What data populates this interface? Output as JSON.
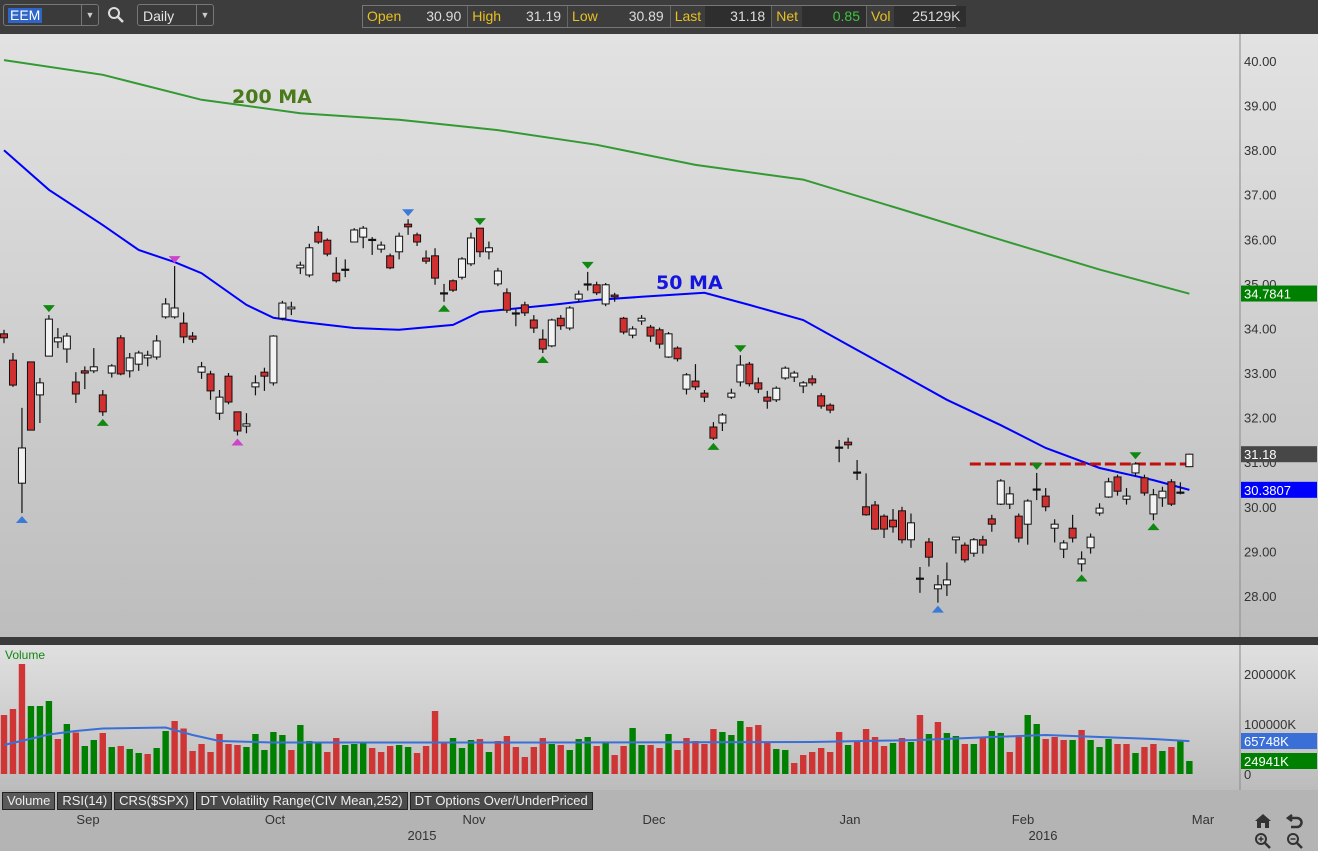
{
  "toolbar": {
    "symbol": "EEM",
    "interval": "Daily",
    "quote": [
      {
        "label": "Open",
        "value": "30.90"
      },
      {
        "label": "High",
        "value": "31.19"
      },
      {
        "label": "Low",
        "value": "30.89"
      },
      {
        "label": "Last",
        "value": "31.18"
      },
      {
        "label": "Net",
        "value": "0.85"
      },
      {
        "label": "Vol",
        "value": "25129K"
      }
    ]
  },
  "tabs": [
    "Volume",
    "RSI(14)",
    "CRS($SPX)",
    "DT Volatility Range(CIV Mean,252)",
    "DT Options Over/UnderPriced"
  ],
  "x_axis": {
    "months": [
      "Sep",
      "Oct",
      "Nov",
      "Dec",
      "Jan",
      "Feb",
      "Mar"
    ],
    "years": [
      "2015",
      "2016"
    ]
  },
  "colors": {
    "up_body": "#f2f2f2",
    "down_body": "#d03030",
    "vol_up": "#008000",
    "vol_down": "#d03535",
    "ma50": "#0000ff",
    "ma200": "#339933",
    "vol_ma": "#3a6fd8",
    "resistance": "#c01010"
  },
  "chart_data": {
    "type": "candlestick",
    "symbol": "EEM",
    "price_axis": {
      "ticks": [
        "28.00",
        "29.00",
        "30.00",
        "31.00",
        "32.00",
        "33.00",
        "34.00",
        "35.00",
        "36.00",
        "37.00",
        "38.00",
        "39.00",
        "40.00"
      ],
      "range": [
        27.5,
        40.5
      ]
    },
    "annotations": {
      "ma200_label": "200 MA",
      "ma50_label": "50 MA",
      "resistance_level": 30.96,
      "resistance_from_index": 108
    },
    "last_labels": {
      "ma200": "34.7841",
      "last": "31.18",
      "ma50": "30.3807"
    },
    "ohlc": [
      [
        33.88,
        33.97,
        33.67,
        33.79
      ],
      [
        33.29,
        33.45,
        32.69,
        32.73
      ],
      [
        30.53,
        32.22,
        29.86,
        31.32
      ],
      [
        33.25,
        33.25,
        31.72,
        31.72
      ],
      [
        32.51,
        32.89,
        31.88,
        32.78
      ],
      [
        33.38,
        34.3,
        33.38,
        34.21
      ],
      [
        33.7,
        34.01,
        33.56,
        33.79
      ],
      [
        33.54,
        33.9,
        33.23,
        33.83
      ],
      [
        32.8,
        33.02,
        32.33,
        32.53
      ],
      [
        33.05,
        33.15,
        32.64,
        33.0
      ],
      [
        33.05,
        33.56,
        33.0,
        33.14
      ],
      [
        32.51,
        32.62,
        32.04,
        32.13
      ],
      [
        33.0,
        33.2,
        32.9,
        33.16
      ],
      [
        33.79,
        33.85,
        32.95,
        32.98
      ],
      [
        33.05,
        33.45,
        32.9,
        33.34
      ],
      [
        33.2,
        33.5,
        33.05,
        33.45
      ],
      [
        33.34,
        33.5,
        33.15,
        33.4
      ],
      [
        33.36,
        33.85,
        33.3,
        33.72
      ],
      [
        34.26,
        34.68,
        34.22,
        34.55
      ],
      [
        34.26,
        35.4,
        34.22,
        34.46
      ],
      [
        34.12,
        34.36,
        33.67,
        33.81
      ],
      [
        33.83,
        33.92,
        33.68,
        33.76
      ],
      [
        33.02,
        33.25,
        32.87,
        33.14
      ],
      [
        32.98,
        33.05,
        32.4,
        32.6
      ],
      [
        32.1,
        32.62,
        31.95,
        32.46
      ],
      [
        32.93,
        33.0,
        32.3,
        32.35
      ],
      [
        32.13,
        32.13,
        31.6,
        31.7
      ],
      [
        31.81,
        32.1,
        31.65,
        31.86
      ],
      [
        32.69,
        32.95,
        32.5,
        32.78
      ],
      [
        33.02,
        33.12,
        32.6,
        32.93
      ],
      [
        32.78,
        33.85,
        32.72,
        33.83
      ],
      [
        34.23,
        34.62,
        34.18,
        34.57
      ],
      [
        34.44,
        34.6,
        34.3,
        34.48
      ],
      [
        35.36,
        35.5,
        35.22,
        35.42
      ],
      [
        35.2,
        35.9,
        35.15,
        35.81
      ],
      [
        36.16,
        36.3,
        35.9,
        35.94
      ],
      [
        35.98,
        36.02,
        35.62,
        35.67
      ],
      [
        35.24,
        35.6,
        35.03,
        35.07
      ],
      [
        35.33,
        35.55,
        35.15,
        35.33
      ],
      [
        35.94,
        36.25,
        35.94,
        36.21
      ],
      [
        36.05,
        36.3,
        35.8,
        36.25
      ],
      [
        36.0,
        36.05,
        35.65,
        36.0
      ],
      [
        35.78,
        35.95,
        35.7,
        35.87
      ],
      [
        35.63,
        35.68,
        35.33,
        35.36
      ],
      [
        35.72,
        36.15,
        35.55,
        36.07
      ],
      [
        36.34,
        36.45,
        36.1,
        36.28
      ],
      [
        36.1,
        36.15,
        35.85,
        35.94
      ],
      [
        35.58,
        35.75,
        35.45,
        35.51
      ],
      [
        35.63,
        35.8,
        34.98,
        35.13
      ],
      [
        34.8,
        35.0,
        34.6,
        34.8
      ],
      [
        35.07,
        35.1,
        34.82,
        34.86
      ],
      [
        35.15,
        35.6,
        35.1,
        35.56
      ],
      [
        35.45,
        36.15,
        35.4,
        36.03
      ],
      [
        36.25,
        36.25,
        35.6,
        35.72
      ],
      [
        35.72,
        35.95,
        35.55,
        35.81
      ],
      [
        35.0,
        35.36,
        34.95,
        35.29
      ],
      [
        34.8,
        34.9,
        34.35,
        34.41
      ],
      [
        34.35,
        34.43,
        34.05,
        34.35
      ],
      [
        34.53,
        34.6,
        34.28,
        34.35
      ],
      [
        34.19,
        34.3,
        33.9,
        34.01
      ],
      [
        33.76,
        33.98,
        33.45,
        33.54
      ],
      [
        33.61,
        34.22,
        33.58,
        34.19
      ],
      [
        34.23,
        34.3,
        33.97,
        34.06
      ],
      [
        34.01,
        34.5,
        33.96,
        34.46
      ],
      [
        34.66,
        34.85,
        34.6,
        34.77
      ],
      [
        35.0,
        35.27,
        34.85,
        35.0
      ],
      [
        34.98,
        35.05,
        34.75,
        34.8
      ],
      [
        34.55,
        35.02,
        34.5,
        34.98
      ],
      [
        34.75,
        34.8,
        34.6,
        34.71
      ],
      [
        34.23,
        34.26,
        33.87,
        33.92
      ],
      [
        33.85,
        34.05,
        33.78,
        33.99
      ],
      [
        34.17,
        34.3,
        34.08,
        34.23
      ],
      [
        34.03,
        34.08,
        33.7,
        33.83
      ],
      [
        33.97,
        34.02,
        33.55,
        33.65
      ],
      [
        33.36,
        33.92,
        33.34,
        33.88
      ],
      [
        33.56,
        33.6,
        33.26,
        33.32
      ],
      [
        32.64,
        33.0,
        32.52,
        32.96
      ],
      [
        32.82,
        33.2,
        32.62,
        32.69
      ],
      [
        32.55,
        32.62,
        32.35,
        32.46
      ],
      [
        31.79,
        31.9,
        31.5,
        31.54
      ],
      [
        31.88,
        32.1,
        31.7,
        32.06
      ],
      [
        32.46,
        32.65,
        32.42,
        32.55
      ],
      [
        32.8,
        33.4,
        32.7,
        33.18
      ],
      [
        33.2,
        33.25,
        32.7,
        32.76
      ],
      [
        32.78,
        32.9,
        32.55,
        32.64
      ],
      [
        32.46,
        32.6,
        32.2,
        32.37
      ],
      [
        32.4,
        32.7,
        32.35,
        32.66
      ],
      [
        32.89,
        33.15,
        32.85,
        33.11
      ],
      [
        32.91,
        33.05,
        32.8,
        33.0
      ],
      [
        32.71,
        32.82,
        32.55,
        32.78
      ],
      [
        32.87,
        32.95,
        32.72,
        32.78
      ],
      [
        32.49,
        32.55,
        32.2,
        32.26
      ],
      [
        32.28,
        32.32,
        32.1,
        32.17
      ],
      [
        31.34,
        31.5,
        31.0,
        31.34
      ],
      [
        31.45,
        31.55,
        31.3,
        31.39
      ],
      [
        30.78,
        31.05,
        30.6,
        30.78
      ],
      [
        30.0,
        30.75,
        29.8,
        29.82
      ],
      [
        30.04,
        30.13,
        29.48,
        29.5
      ],
      [
        29.79,
        29.83,
        29.3,
        29.5
      ],
      [
        29.7,
        29.95,
        29.42,
        29.55
      ],
      [
        29.91,
        30.0,
        29.18,
        29.26
      ],
      [
        29.26,
        29.85,
        29.08,
        29.64
      ],
      [
        28.4,
        28.65,
        28.07,
        28.4
      ],
      [
        29.21,
        29.3,
        28.66,
        28.87
      ],
      [
        28.16,
        28.47,
        27.85,
        28.25
      ],
      [
        28.25,
        28.75,
        28.0,
        28.36
      ],
      [
        29.26,
        29.32,
        28.95,
        29.32
      ],
      [
        29.14,
        29.2,
        28.75,
        28.81
      ],
      [
        28.96,
        29.3,
        28.88,
        29.26
      ],
      [
        29.26,
        29.35,
        28.95,
        29.14
      ],
      [
        29.73,
        29.82,
        29.44,
        29.61
      ],
      [
        30.06,
        30.62,
        30.04,
        30.58
      ],
      [
        30.06,
        30.45,
        29.95,
        30.29
      ],
      [
        29.79,
        29.85,
        29.2,
        29.3
      ],
      [
        29.61,
        30.17,
        29.15,
        30.13
      ],
      [
        30.4,
        30.76,
        30.15,
        30.4
      ],
      [
        30.24,
        30.42,
        29.9,
        30.0
      ],
      [
        29.52,
        29.72,
        29.2,
        29.61
      ],
      [
        29.05,
        29.25,
        28.85,
        29.19
      ],
      [
        29.52,
        29.82,
        29.2,
        29.3
      ],
      [
        28.72,
        29.0,
        28.55,
        28.83
      ],
      [
        29.08,
        29.4,
        28.95,
        29.32
      ],
      [
        29.86,
        30.08,
        29.8,
        29.97
      ],
      [
        30.22,
        30.65,
        30.2,
        30.56
      ],
      [
        30.67,
        30.72,
        30.25,
        30.35
      ],
      [
        30.17,
        30.42,
        30.05,
        30.24
      ],
      [
        30.76,
        31.0,
        30.7,
        30.96
      ],
      [
        30.65,
        30.72,
        30.25,
        30.31
      ],
      [
        29.84,
        30.4,
        29.7,
        30.27
      ],
      [
        30.2,
        30.45,
        30.0,
        30.35
      ],
      [
        30.56,
        30.62,
        30.02,
        30.06
      ],
      [
        30.33,
        30.55,
        30.28,
        30.33
      ],
      [
        30.9,
        31.19,
        30.89,
        31.18
      ]
    ],
    "ma200": [
      [
        0,
        40.02
      ],
      [
        11,
        39.69
      ],
      [
        22,
        39.13
      ],
      [
        33,
        38.83
      ],
      [
        44,
        38.68
      ],
      [
        55,
        38.45
      ],
      [
        66,
        38.12
      ],
      [
        77,
        37.67
      ],
      [
        89,
        37.34
      ],
      [
        100,
        36.67
      ],
      [
        111,
        35.99
      ],
      [
        122,
        35.32
      ],
      [
        132,
        34.78
      ]
    ],
    "ma50": [
      [
        0,
        38.0
      ],
      [
        5,
        37.11
      ],
      [
        11,
        36.32
      ],
      [
        15,
        35.76
      ],
      [
        19,
        35.49
      ],
      [
        22,
        35.24
      ],
      [
        27,
        34.53
      ],
      [
        30,
        34.24
      ],
      [
        33,
        34.15
      ],
      [
        39,
        34.01
      ],
      [
        44,
        33.97
      ],
      [
        50,
        34.08
      ],
      [
        53,
        34.37
      ],
      [
        55,
        34.41
      ],
      [
        61,
        34.53
      ],
      [
        66,
        34.64
      ],
      [
        71,
        34.71
      ],
      [
        78,
        34.8
      ],
      [
        83,
        34.53
      ],
      [
        89,
        34.19
      ],
      [
        94,
        33.63
      ],
      [
        100,
        32.96
      ],
      [
        105,
        32.4
      ],
      [
        111,
        31.83
      ],
      [
        116,
        31.32
      ],
      [
        122,
        30.87
      ],
      [
        128,
        30.6
      ],
      [
        132,
        30.38
      ]
    ],
    "markers": [
      {
        "i": 2,
        "pos": "below",
        "color": "#3a7ad8"
      },
      {
        "i": 5,
        "pos": "above",
        "color": "#118811"
      },
      {
        "i": 11,
        "pos": "below",
        "color": "#118811"
      },
      {
        "i": 19,
        "pos": "above",
        "color": "#cc44cc"
      },
      {
        "i": 26,
        "pos": "below",
        "color": "#cc44cc"
      },
      {
        "i": 45,
        "pos": "above",
        "color": "#3a7ad8"
      },
      {
        "i": 49,
        "pos": "below",
        "color": "#118811"
      },
      {
        "i": 53,
        "pos": "above",
        "color": "#118811"
      },
      {
        "i": 60,
        "pos": "below",
        "color": "#118811"
      },
      {
        "i": 65,
        "pos": "above",
        "color": "#118811"
      },
      {
        "i": 79,
        "pos": "below",
        "color": "#118811"
      },
      {
        "i": 82,
        "pos": "above",
        "color": "#118811"
      },
      {
        "i": 104,
        "pos": "below",
        "color": "#3a7ad8"
      },
      {
        "i": 115,
        "pos": "above",
        "color": "#118811"
      },
      {
        "i": 120,
        "pos": "below",
        "color": "#118811"
      },
      {
        "i": 126,
        "pos": "above",
        "color": "#118811"
      },
      {
        "i": 128,
        "pos": "below",
        "color": "#118811"
      }
    ],
    "volume": {
      "title": "Volume",
      "ticks": [
        "200000K",
        "100000K",
        "0"
      ],
      "last_labels": {
        "ma": "65748K",
        "last": "24941K"
      },
      "values_k": [
        118000,
        130000,
        220000,
        136000,
        136000,
        146000,
        70000,
        100000,
        83000,
        56000,
        68000,
        82000,
        54000,
        56000,
        50000,
        42000,
        40000,
        52000,
        86000,
        106000,
        91000,
        46000,
        60000,
        44000,
        80000,
        60000,
        58000,
        54000,
        80000,
        48000,
        84000,
        78000,
        48000,
        98000,
        66000,
        62000,
        44000,
        72000,
        58000,
        60000,
        62000,
        52000,
        44000,
        56000,
        58000,
        54000,
        42000,
        56000,
        126000,
        64667,
        72000,
        52000,
        68000,
        70000,
        44000,
        66000,
        76000,
        54000,
        34000,
        54000,
        72000,
        60000,
        58000,
        48000,
        70000,
        74000,
        56000,
        62000,
        38000,
        56000,
        92000,
        58000,
        58000,
        52000,
        80000,
        48000,
        72000,
        66000,
        60000,
        90000,
        84000,
        78000,
        106000,
        94000,
        98000,
        64000,
        50000,
        48000,
        22000,
        38000,
        44000,
        52000,
        44000,
        84000,
        58000,
        66000,
        90000,
        74000,
        56000,
        62000,
        72000,
        64000,
        118000,
        80000,
        104000,
        82000,
        76000,
        60000,
        60000,
        74000,
        86000,
        82000,
        44000,
        74000,
        118000,
        100000,
        70000,
        74000,
        68000,
        68000,
        88000,
        68000,
        54000,
        70000,
        60000,
        60000,
        42000,
        54000,
        60000,
        46000,
        54000,
        66000,
        26000
      ],
      "ma": [
        [
          0,
          58000
        ],
        [
          5,
          79000
        ],
        [
          8,
          86000
        ],
        [
          11,
          91000
        ],
        [
          18,
          93000
        ],
        [
          21,
          78000
        ],
        [
          24,
          66000
        ],
        [
          30,
          63000
        ],
        [
          60,
          63000
        ],
        [
          90,
          64000
        ],
        [
          102,
          68000
        ],
        [
          110,
          74000
        ],
        [
          116,
          78000
        ],
        [
          122,
          74000
        ],
        [
          128,
          70000
        ],
        [
          132,
          65748
        ]
      ]
    }
  }
}
